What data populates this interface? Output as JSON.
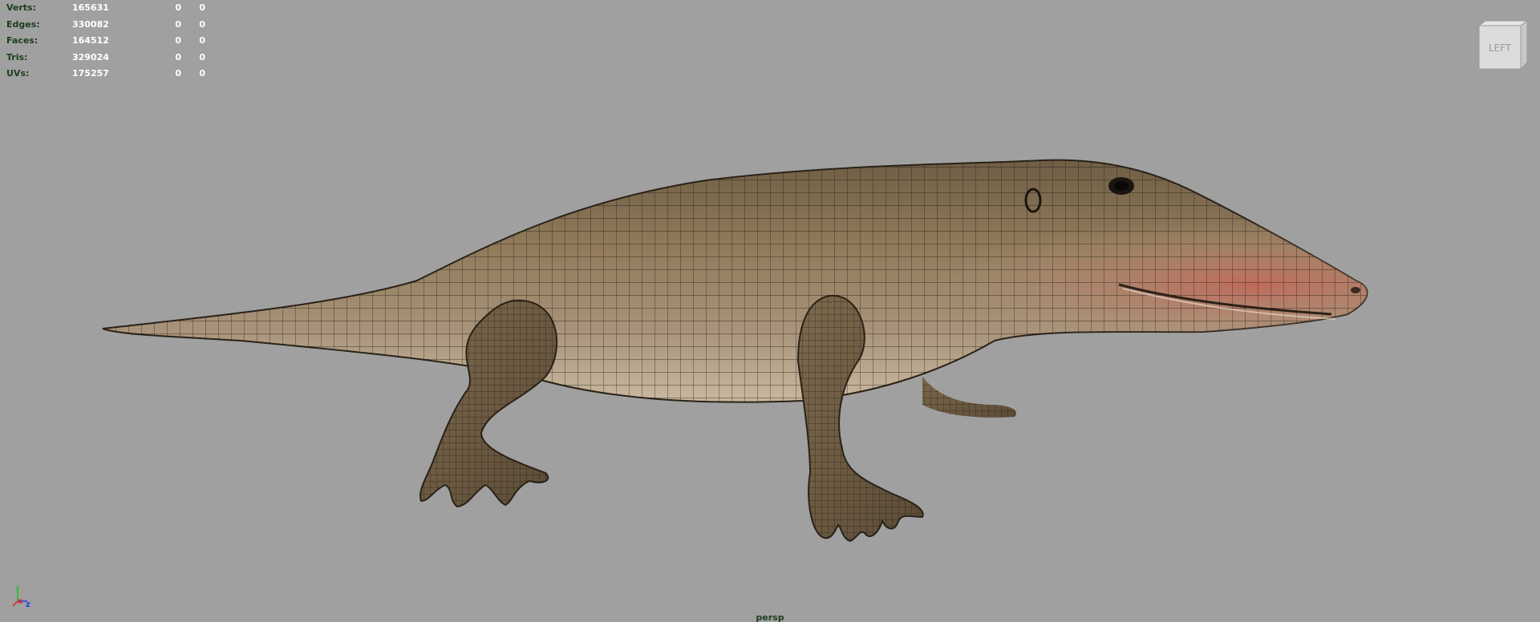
{
  "hud": {
    "rows": [
      {
        "label": "Verts:",
        "value": "165631",
        "selected": "0",
        "uv": "0"
      },
      {
        "label": "Edges:",
        "value": "330082",
        "selected": "0",
        "uv": "0"
      },
      {
        "label": "Faces:",
        "value": "164512",
        "selected": "0",
        "uv": "0"
      },
      {
        "label": "Tris:",
        "value": "329024",
        "selected": "0",
        "uv": "0"
      },
      {
        "label": "UVs:",
        "value": "175257",
        "selected": "0",
        "uv": "0"
      }
    ]
  },
  "viewcube": {
    "face_label": "LEFT"
  },
  "camera": {
    "name": "persp"
  },
  "axis": {
    "x": "x",
    "y": "y",
    "z": "z",
    "colors": {
      "x": "#e02020",
      "y": "#20c020",
      "z": "#2040e0"
    }
  },
  "colors": {
    "background": "#a0a0a0",
    "hud_label": "#1c3d1c",
    "hud_value": "#ffffff",
    "skin": "#8a7658",
    "belly": "#b8a384",
    "wire": "#1a1510",
    "snout": "#c07060"
  },
  "icons": [
    "viewcube-icon",
    "axis-gizmo-icon"
  ]
}
